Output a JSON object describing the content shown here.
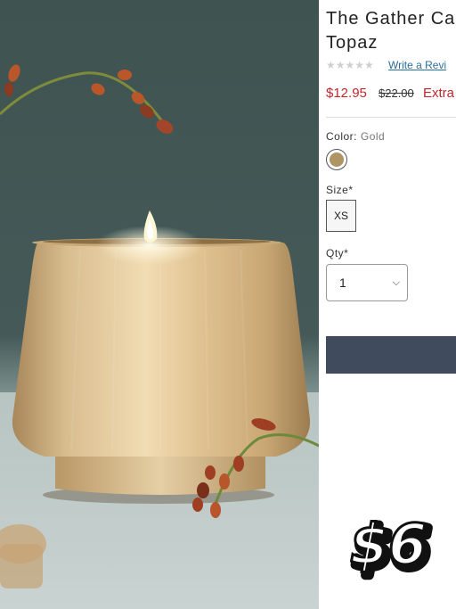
{
  "product": {
    "title_line1": "The Gather Ca",
    "title_line2": "Topaz",
    "rating_stars": "★★★★★",
    "write_review": "Write a Revi",
    "price": "$12.95",
    "was_price": "$22.00",
    "extra_text": "Extra",
    "color_label": "Color:",
    "color_value": "Gold",
    "swatch_color": "#b09564",
    "size_label": "Size*",
    "size_option": "XS",
    "qty_label": "Qty*",
    "qty_value": "1",
    "cart_button_color": "#404c5e"
  },
  "sticker": {
    "text": "$6"
  },
  "colors": {
    "sale_red": "#c2272d",
    "link_blue": "#2a6e9c"
  }
}
